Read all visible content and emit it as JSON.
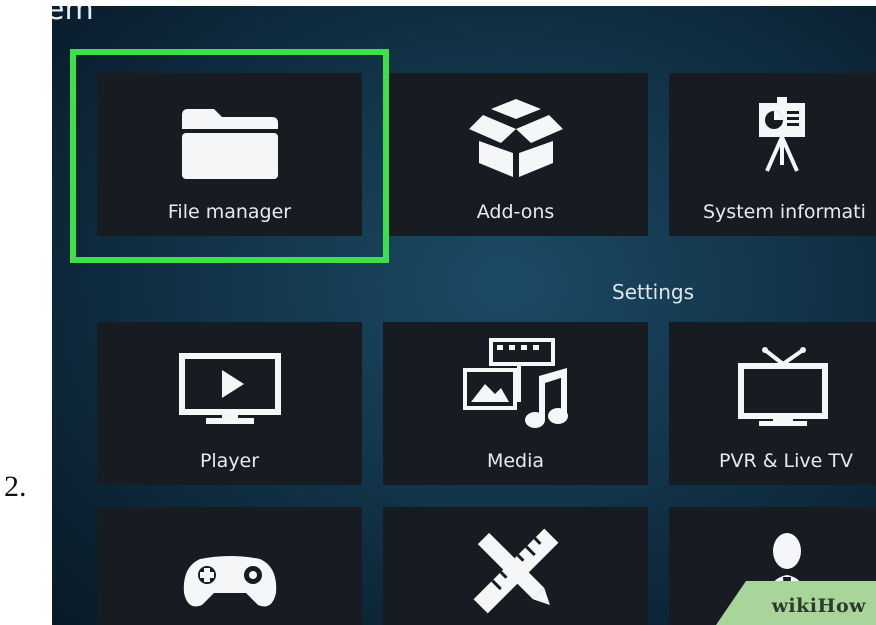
{
  "step_number": "2.",
  "window": {
    "partial_title": "em"
  },
  "system_tiles": [
    {
      "label": "File manager",
      "icon": "folder-icon"
    },
    {
      "label": "Add-ons",
      "icon": "open-box-icon"
    },
    {
      "label": "System informati",
      "icon": "presentation-easel-icon"
    }
  ],
  "settings_section": {
    "title": "Settings"
  },
  "settings_tiles": [
    {
      "label": "Player",
      "icon": "monitor-play-icon"
    },
    {
      "label": "Media",
      "icon": "media-film-music-icon"
    },
    {
      "label": "PVR & Live TV",
      "icon": "tv-antenna-icon"
    },
    {
      "label": "",
      "icon": "gamepad-icon"
    },
    {
      "label": "",
      "icon": "ruler-pencil-icon"
    },
    {
      "label": "",
      "icon": "person-icon"
    }
  ],
  "highlight": {
    "color": "#3ee04a",
    "target": "File manager"
  },
  "watermark": {
    "text": "wikiHow"
  }
}
